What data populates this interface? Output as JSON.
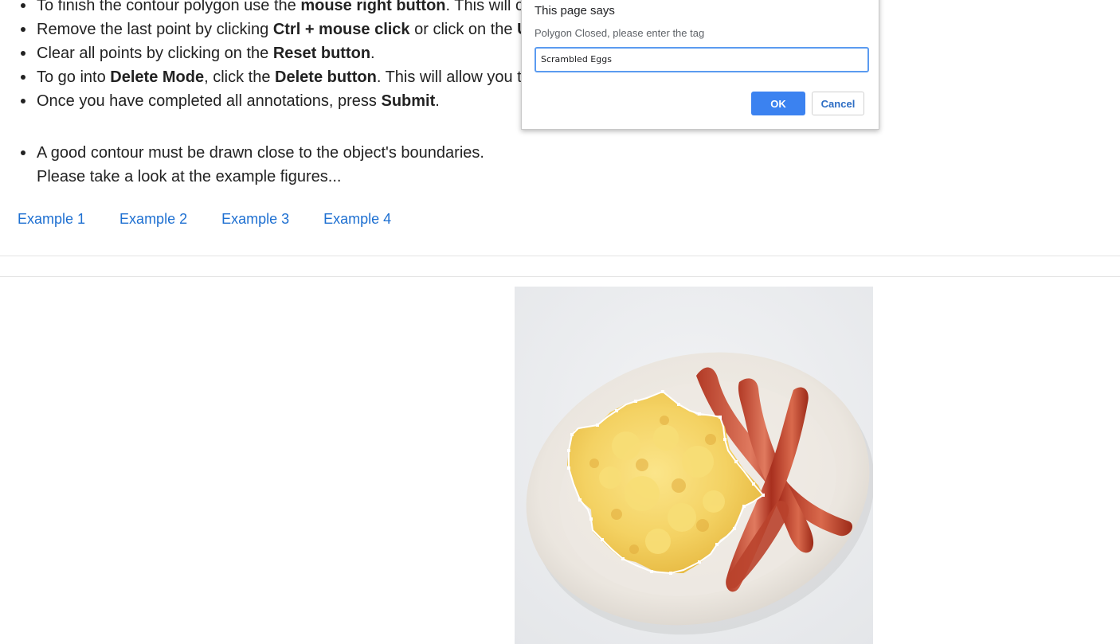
{
  "instructions": {
    "list1": [
      {
        "pre": "To finish the contour polygon use the ",
        "bold": "mouse right button",
        "post": ". This will c"
      },
      {
        "pre": "Remove the last point by clicking ",
        "bold": "Ctrl + mouse click",
        "post": " or click on the ",
        "bold2": "U"
      },
      {
        "pre": "Clear all points by clicking on the ",
        "bold": "Reset button",
        "post": "."
      },
      {
        "pre": "To go into ",
        "bold": "Delete Mode",
        "post": ", click the ",
        "bold2": "Delete button",
        "post2": ". This will allow you t"
      },
      {
        "pre": "Once you have completed all annotations, press ",
        "bold": "Submit",
        "post": "."
      }
    ],
    "list2_line1": "A good contour must be drawn close to the object's boundaries.",
    "list2_line2": "Please take a look at the example figures..."
  },
  "examples": [
    "Example 1",
    "Example 2",
    "Example 3",
    "Example 4"
  ],
  "dialog": {
    "title": "This page says",
    "message": "Polygon Closed, please enter the tag",
    "input_value": "Scrambled Eggs",
    "ok_label": "OK",
    "cancel_label": "Cancel"
  },
  "colors": {
    "link": "#1d6fd1",
    "ok_button": "#3b82f0",
    "input_focus": "#5b9bf0"
  }
}
